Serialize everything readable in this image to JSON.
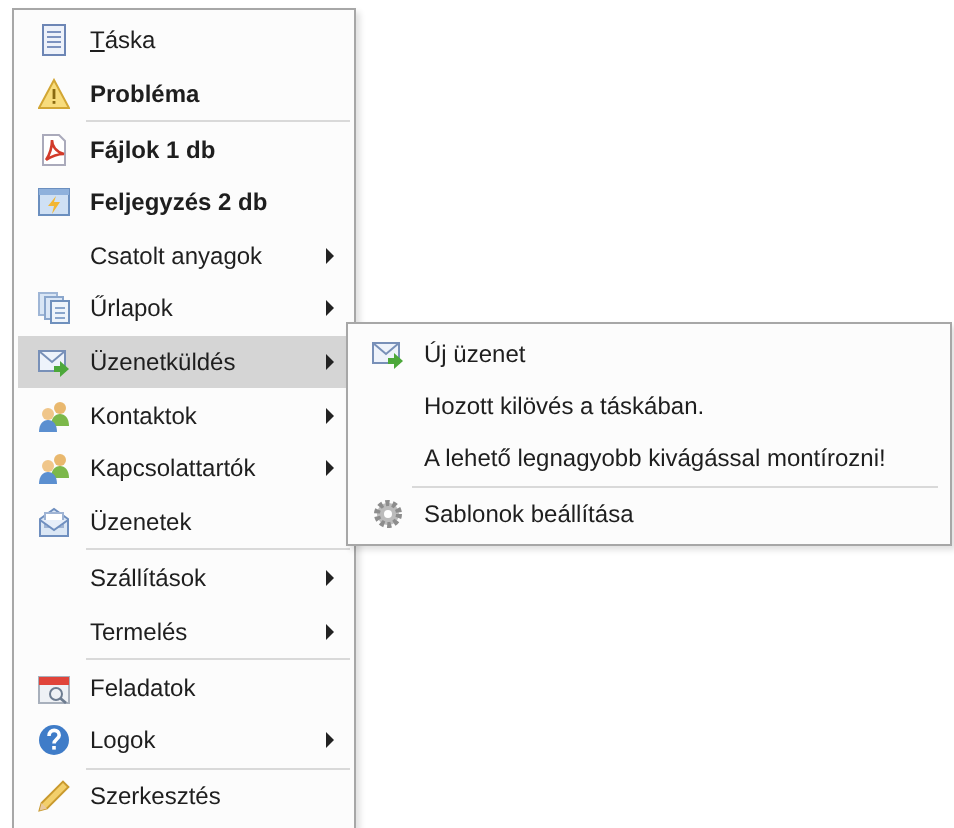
{
  "menu": {
    "items": [
      {
        "kind": "item",
        "label": "Táska",
        "access_key_first": true,
        "bold": false,
        "submenu_arrow": false,
        "selected": false
      },
      {
        "kind": "item",
        "label": "Probléma",
        "bold": true,
        "submenu_arrow": false,
        "selected": false
      },
      {
        "kind": "separator"
      },
      {
        "kind": "item",
        "label": "Fájlok 1 db",
        "bold": true,
        "submenu_arrow": false,
        "selected": false
      },
      {
        "kind": "item",
        "label": "Feljegyzés 2 db",
        "bold": true,
        "submenu_arrow": false,
        "selected": false
      },
      {
        "kind": "item",
        "label": "Csatolt anyagok",
        "bold": false,
        "submenu_arrow": true,
        "selected": false
      },
      {
        "kind": "item",
        "label": "Űrlapok",
        "bold": false,
        "submenu_arrow": true,
        "selected": false
      },
      {
        "kind": "item",
        "label": "Üzenetküldés",
        "bold": false,
        "submenu_arrow": true,
        "selected": true,
        "submenu": [
          {
            "kind": "item",
            "label": "Új üzenet"
          },
          {
            "kind": "item",
            "label": "Hozott kilövés a táskában."
          },
          {
            "kind": "item",
            "label": "A lehető legnagyobb kivágással montírozni!"
          },
          {
            "kind": "separator"
          },
          {
            "kind": "item",
            "label": "Sablonok beállítása"
          }
        ]
      },
      {
        "kind": "item",
        "label": "Kontaktok",
        "bold": false,
        "submenu_arrow": true,
        "selected": false
      },
      {
        "kind": "item",
        "label": "Kapcsolattartók",
        "bold": false,
        "submenu_arrow": true,
        "selected": false
      },
      {
        "kind": "item",
        "label": "Üzenetek",
        "bold": false,
        "submenu_arrow": false,
        "selected": false
      },
      {
        "kind": "separator"
      },
      {
        "kind": "item",
        "label": "Szállítások",
        "bold": false,
        "submenu_arrow": true,
        "selected": false
      },
      {
        "kind": "item",
        "label": "Termelés",
        "bold": false,
        "submenu_arrow": true,
        "selected": false
      },
      {
        "kind": "separator"
      },
      {
        "kind": "item",
        "label": "Feladatok",
        "bold": false,
        "submenu_arrow": false,
        "selected": false
      },
      {
        "kind": "item",
        "label": "Logok",
        "bold": false,
        "submenu_arrow": true,
        "selected": false
      },
      {
        "kind": "separator"
      },
      {
        "kind": "item",
        "label": "Szerkesztés",
        "bold": false,
        "submenu_arrow": false,
        "selected": false
      }
    ]
  }
}
